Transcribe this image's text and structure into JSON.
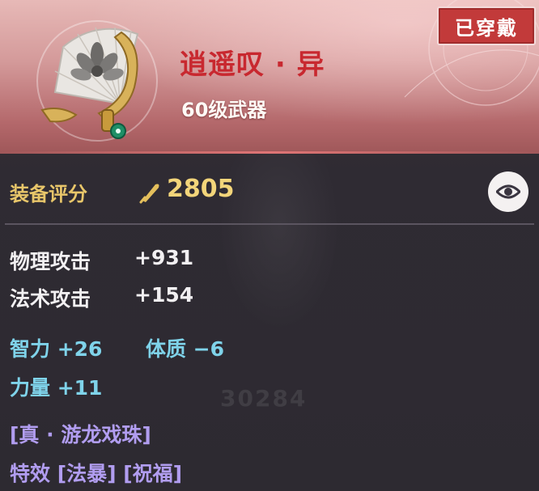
{
  "item": {
    "name": "逍遥叹 · 异",
    "level_text": "60级武器",
    "icon": "fan-weapon-icon",
    "equipped_label": "已穿戴"
  },
  "score": {
    "label": "装备评分",
    "icon": "feather-pen-icon",
    "value": "2805"
  },
  "view_button": {
    "icon": "eye-icon"
  },
  "stats": {
    "physical_attack": {
      "label": "物理攻击",
      "value": "+931"
    },
    "magic_attack": {
      "label": "法术攻击",
      "value": "+154"
    },
    "intelligence": "智力 +26",
    "constitution": "体质 −6",
    "strength": "力量 +11"
  },
  "special": {
    "skill": "[真 · 游龙戏珠]",
    "effects": "特效 [法暴] [祝福]"
  },
  "background_faded_score": "30284",
  "colors": {
    "name_red": "#c8282f",
    "score_gold": "#f3d57a",
    "attribute_cyan": "#7fd3ea",
    "special_purple": "#b19df0",
    "badge_red": "#c23a3a"
  }
}
